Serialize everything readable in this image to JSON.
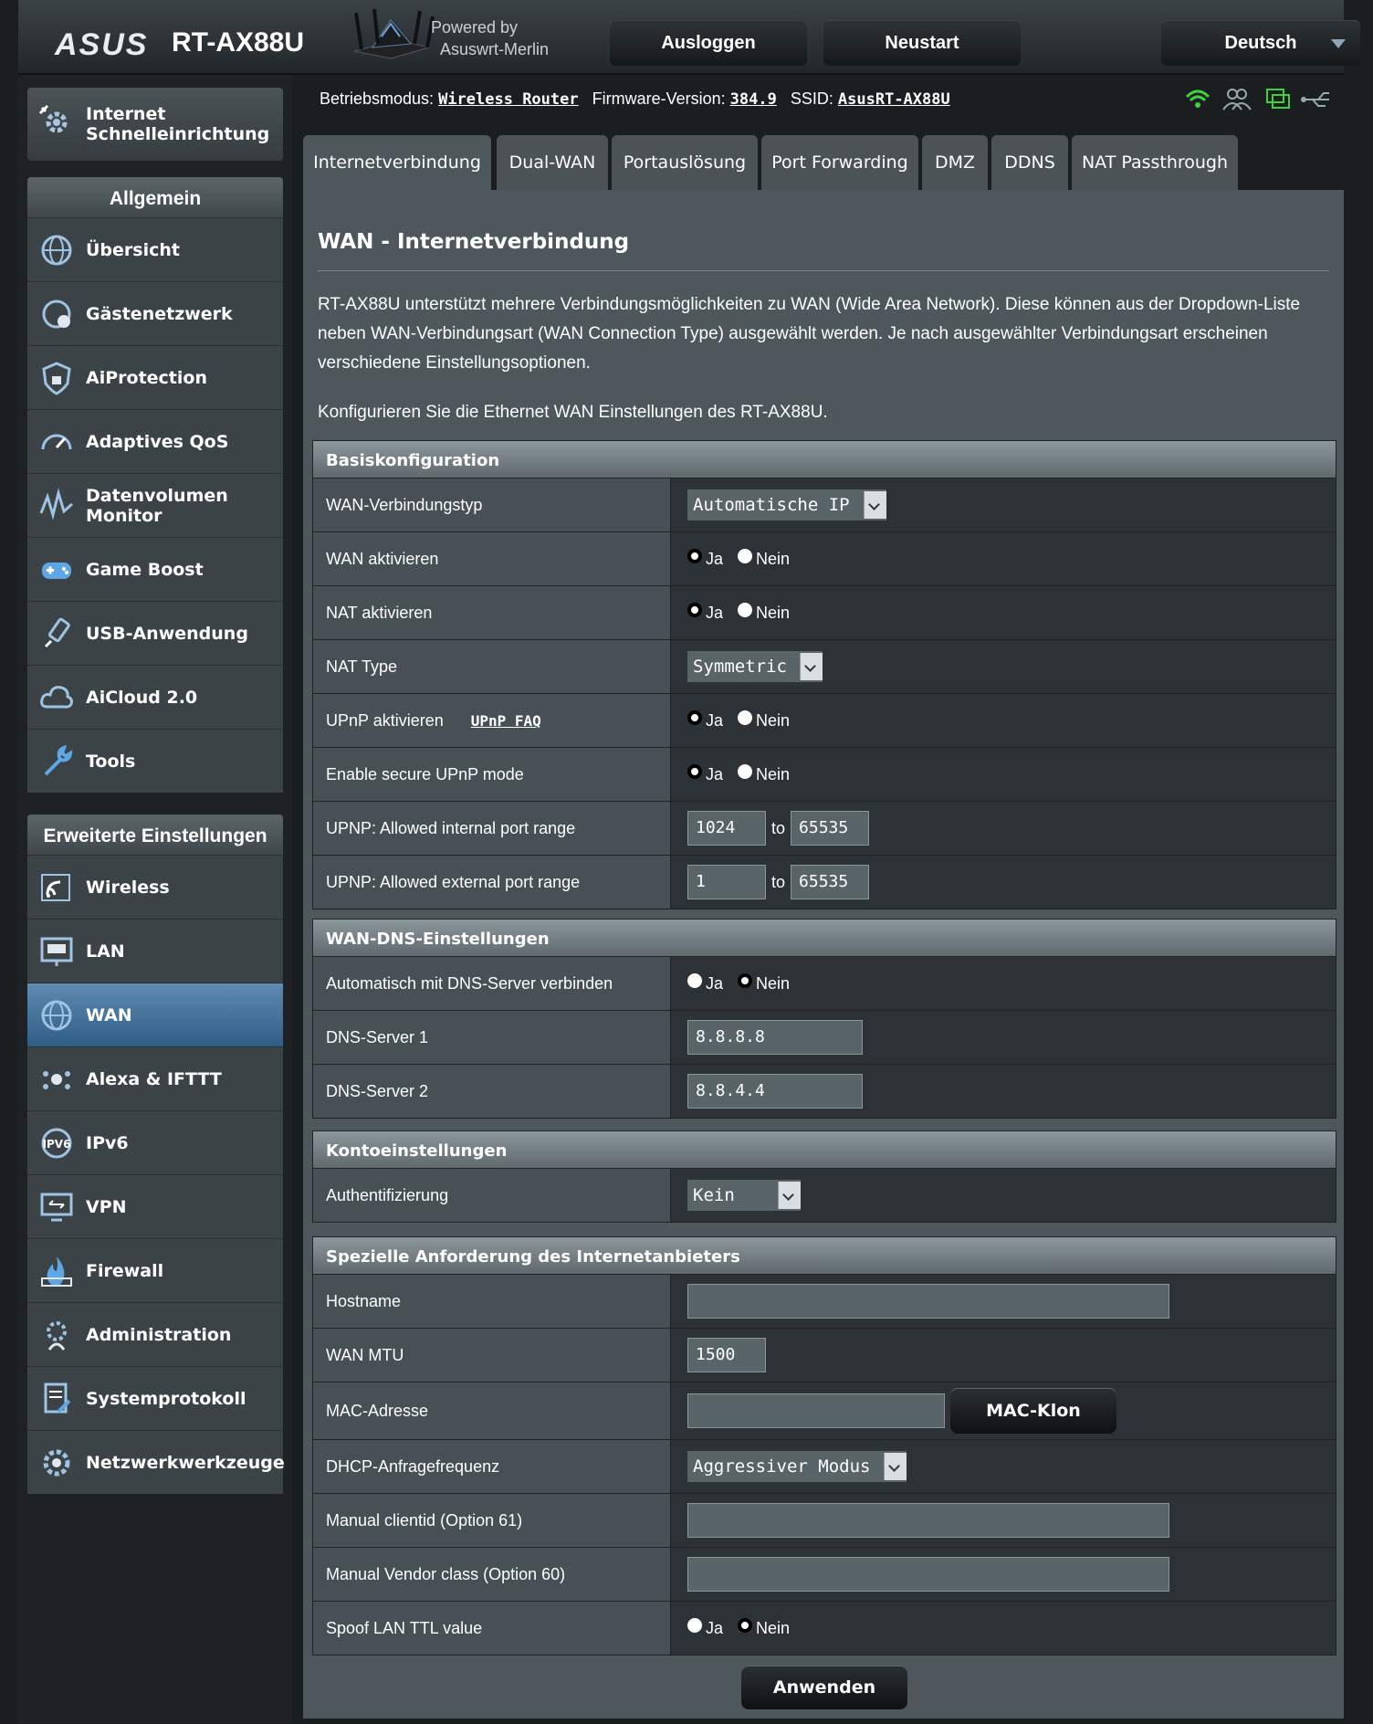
{
  "header": {
    "brand": "ASUS",
    "model": "RT-AX88U",
    "powered_line1": "Powered by",
    "powered_line2": "Asuswrt-Merlin",
    "logout": "Ausloggen",
    "reboot": "Neustart",
    "language": "Deutsch"
  },
  "status": {
    "mode_label": "Betriebsmodus:",
    "mode_value": "Wireless Router",
    "firmware_label": "Firmware-Version:",
    "firmware_value": "384.9",
    "ssid_label": "SSID:",
    "ssid_value": "AsusRT-AX88U"
  },
  "sidebar": {
    "quick_setup": "Internet Schnelleinrichtung",
    "general_title": "Allgemein",
    "general_items": [
      "Übersicht",
      "Gästenetzwerk",
      "AiProtection",
      "Adaptives QoS",
      "Datenvolumen Monitor",
      "Game Boost",
      "USB-Anwendung",
      "AiCloud 2.0",
      "Tools"
    ],
    "advanced_title": "Erweiterte Einstellungen",
    "advanced_items": [
      "Wireless",
      "LAN",
      "WAN",
      "Alexa & IFTTT",
      "IPv6",
      "VPN",
      "Firewall",
      "Administration",
      "Systemprotokoll",
      "Netzwerkwerkzeuge"
    ],
    "active_item": "WAN"
  },
  "tabs": [
    "Internetverbindung",
    "Dual-WAN",
    "Portauslösung",
    "Port Forwarding",
    "DMZ",
    "DDNS",
    "NAT Passthrough"
  ],
  "active_tab": "Internetverbindung",
  "page": {
    "title": "WAN - Internetverbindung",
    "description1": "RT-AX88U unterstützt mehrere Verbindungsmöglichkeiten zu WAN (Wide Area Network). Diese können aus der Dropdown-Liste neben WAN-Verbindungsart (WAN Connection Type) ausgewählt werden. Je nach ausgewählter Verbindungsart erscheinen verschiedene Einstellungsoptionen.",
    "description2": "Konfigurieren Sie die Ethernet WAN Einstellungen des RT-AX88U."
  },
  "radio_labels": {
    "yes": "Ja",
    "no": "Nein"
  },
  "basic": {
    "title": "Basiskonfiguration",
    "wan_type_label": "WAN-Verbindungstyp",
    "wan_type_value": "Automatische IP",
    "wan_enable_label": "WAN aktivieren",
    "wan_enable_value": "Ja",
    "nat_enable_label": "NAT aktivieren",
    "nat_enable_value": "Ja",
    "nat_type_label": "NAT Type",
    "nat_type_value": "Symmetric",
    "upnp_label": "UPnP aktivieren",
    "upnp_faq": "UPnP  FAQ",
    "upnp_value": "Ja",
    "secure_upnp_label": "Enable secure UPnP mode",
    "secure_upnp_value": "Ja",
    "upnp_int_label": "UPNP: Allowed internal port range",
    "upnp_int_from": "1024",
    "upnp_int_to": "65535",
    "upnp_ext_label": "UPNP: Allowed external port range",
    "upnp_ext_from": "1",
    "upnp_ext_to": "65535",
    "to_label": "to"
  },
  "dns": {
    "title": "WAN-DNS-Einstellungen",
    "auto_label": "Automatisch mit DNS-Server verbinden",
    "auto_value": "Nein",
    "dns1_label": "DNS-Server 1",
    "dns1_value": "8.8.8.8",
    "dns2_label": "DNS-Server 2",
    "dns2_value": "8.8.4.4"
  },
  "account": {
    "title": "Kontoeinstellungen",
    "auth_label": "Authentifizierung",
    "auth_value": "Kein"
  },
  "isp": {
    "title": "Spezielle Anforderung des Internetanbieters",
    "hostname_label": "Hostname",
    "hostname_value": "",
    "mtu_label": "WAN MTU",
    "mtu_value": "1500",
    "mac_label": "MAC-Adresse",
    "mac_value": "",
    "mac_clone": "MAC-Klon",
    "dhcp_label": "DHCP-Anfragefrequenz",
    "dhcp_value": "Aggressiver Modus",
    "opt61_label": "Manual clientid (Option 61)",
    "opt61_value": "",
    "opt60_label": "Manual Vendor class (Option 60)",
    "opt60_value": "",
    "ttl_label": "Spoof LAN TTL value",
    "ttl_value": "Nein"
  },
  "apply": "Anwenden"
}
